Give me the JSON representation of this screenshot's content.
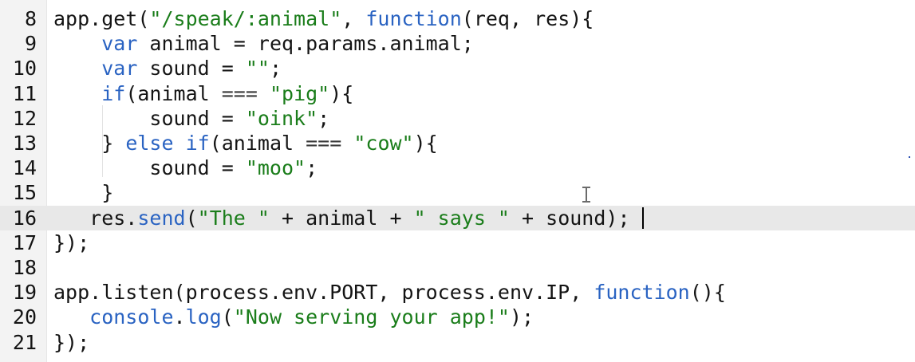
{
  "editor": {
    "active_line": "16",
    "colors": {
      "keyword": "#2a63c2",
      "string": "#1a7d1a",
      "text": "#141414",
      "active_line_bg": "#e8e8e8",
      "gutter_bg": "#f3f3f3"
    },
    "lines": [
      {
        "num": "8",
        "tokens": [
          {
            "t": "app.get(",
            "c": "plain"
          },
          {
            "t": "\"/speak/:animal\"",
            "c": "str"
          },
          {
            "t": ", ",
            "c": "plain"
          },
          {
            "t": "function",
            "c": "kw"
          },
          {
            "t": "(req, res){",
            "c": "plain"
          }
        ]
      },
      {
        "num": "9",
        "tokens": [
          {
            "t": "    ",
            "c": "plain"
          },
          {
            "t": "var",
            "c": "kw"
          },
          {
            "t": " animal = req.params.animal;",
            "c": "plain"
          }
        ]
      },
      {
        "num": "10",
        "tokens": [
          {
            "t": "    ",
            "c": "plain"
          },
          {
            "t": "var",
            "c": "kw"
          },
          {
            "t": " sound = ",
            "c": "plain"
          },
          {
            "t": "\"\"",
            "c": "str"
          },
          {
            "t": ";",
            "c": "plain"
          }
        ]
      },
      {
        "num": "11",
        "tokens": [
          {
            "t": "    ",
            "c": "plain"
          },
          {
            "t": "if",
            "c": "kw"
          },
          {
            "t": "(animal ",
            "c": "plain"
          },
          {
            "t": "===",
            "c": "op"
          },
          {
            "t": " ",
            "c": "plain"
          },
          {
            "t": "\"pig\"",
            "c": "str"
          },
          {
            "t": "){",
            "c": "plain"
          }
        ]
      },
      {
        "num": "12",
        "tokens": [
          {
            "t": "        sound = ",
            "c": "plain"
          },
          {
            "t": "\"oink\"",
            "c": "str"
          },
          {
            "t": ";",
            "c": "plain"
          }
        ]
      },
      {
        "num": "13",
        "tokens": [
          {
            "t": "    } ",
            "c": "plain"
          },
          {
            "t": "else",
            "c": "kw"
          },
          {
            "t": " ",
            "c": "plain"
          },
          {
            "t": "if",
            "c": "kw"
          },
          {
            "t": "(animal ",
            "c": "plain"
          },
          {
            "t": "===",
            "c": "op"
          },
          {
            "t": " ",
            "c": "plain"
          },
          {
            "t": "\"cow\"",
            "c": "str"
          },
          {
            "t": "){",
            "c": "plain"
          }
        ]
      },
      {
        "num": "14",
        "tokens": [
          {
            "t": "        sound = ",
            "c": "plain"
          },
          {
            "t": "\"moo\"",
            "c": "str"
          },
          {
            "t": ";",
            "c": "plain"
          }
        ]
      },
      {
        "num": "15",
        "tokens": [
          {
            "t": "    }",
            "c": "plain"
          }
        ]
      },
      {
        "num": "16",
        "tokens": [
          {
            "t": "   res.",
            "c": "plain"
          },
          {
            "t": "send",
            "c": "kw"
          },
          {
            "t": "(",
            "c": "plain"
          },
          {
            "t": "\"The \"",
            "c": "str"
          },
          {
            "t": " + animal + ",
            "c": "plain"
          },
          {
            "t": "\" says \"",
            "c": "str"
          },
          {
            "t": " + sound); ",
            "c": "plain"
          }
        ]
      },
      {
        "num": "17",
        "tokens": [
          {
            "t": "});",
            "c": "plain"
          }
        ]
      },
      {
        "num": "18",
        "tokens": []
      },
      {
        "num": "19",
        "tokens": [
          {
            "t": "app.listen(process.env.PORT, process.env.IP, ",
            "c": "plain"
          },
          {
            "t": "function",
            "c": "kw"
          },
          {
            "t": "(){",
            "c": "plain"
          }
        ]
      },
      {
        "num": "20",
        "tokens": [
          {
            "t": "   ",
            "c": "plain"
          },
          {
            "t": "console",
            "c": "kw"
          },
          {
            "t": ".",
            "c": "plain"
          },
          {
            "t": "log",
            "c": "kw"
          },
          {
            "t": "(",
            "c": "plain"
          },
          {
            "t": "\"Now serving your app!\"",
            "c": "str"
          },
          {
            "t": ");",
            "c": "plain"
          }
        ]
      },
      {
        "num": "21",
        "tokens": [
          {
            "t": "});",
            "c": "plain"
          }
        ]
      }
    ]
  }
}
